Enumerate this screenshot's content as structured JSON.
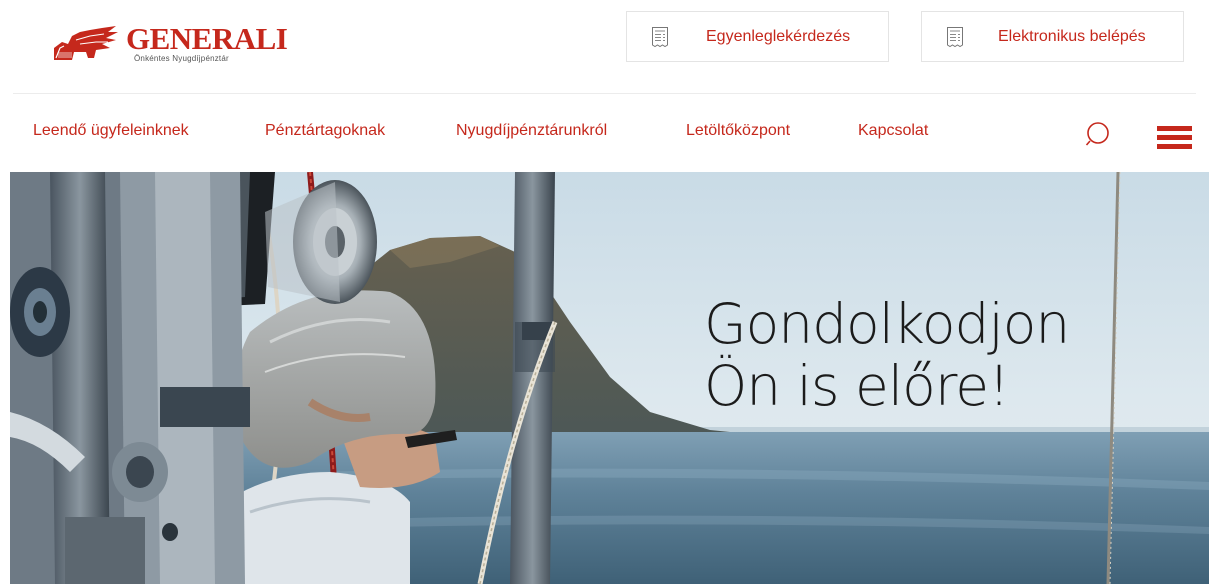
{
  "brand": {
    "name": "GENERALI",
    "subtitle": "Önkéntes Nyugdíjpénztár",
    "color": "#c5281c"
  },
  "quick_links": [
    {
      "label": "Egyenleglekérdezés",
      "icon": "document-icon"
    },
    {
      "label": "Elektronikus belépés",
      "icon": "document-icon"
    }
  ],
  "nav": {
    "items": [
      {
        "label": "Leendő ügyfeleinknek"
      },
      {
        "label": "Pénztártagoknak"
      },
      {
        "label": "Nyugdíjpénztárunkról"
      },
      {
        "label": "Letöltőközpont"
      },
      {
        "label": "Kapcsolat"
      }
    ],
    "search_icon": "search-icon",
    "menu_icon": "hamburger-menu-icon"
  },
  "hero": {
    "headline_line1": "Gondolkodjon",
    "headline_line2": "Ön is előre!",
    "image_description": "sailboat-sea-scene"
  }
}
